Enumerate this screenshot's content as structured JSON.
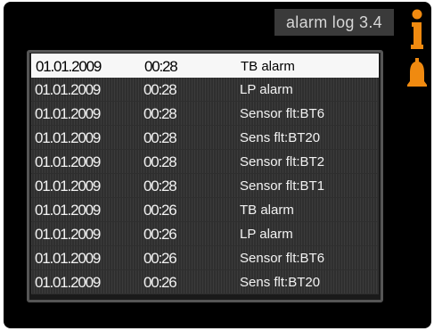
{
  "header": {
    "title": "alarm log",
    "menu_number": "3.4"
  },
  "icons": {
    "info": "info-icon",
    "alarm": "bell-icon",
    "accent_color": "#f08a10"
  },
  "log": {
    "rows": [
      {
        "date": "01.01.2009",
        "time": "00:28",
        "event": "TB alarm",
        "selected": true
      },
      {
        "date": "01.01.2009",
        "time": "00:28",
        "event": "LP alarm",
        "selected": false
      },
      {
        "date": "01.01.2009",
        "time": "00:28",
        "event": "Sensor flt:BT6",
        "selected": false
      },
      {
        "date": "01.01.2009",
        "time": "00:28",
        "event": "Sens flt:BT20",
        "selected": false
      },
      {
        "date": "01.01.2009",
        "time": "00:28",
        "event": "Sensor flt:BT2",
        "selected": false
      },
      {
        "date": "01.01.2009",
        "time": "00:28",
        "event": "Sensor flt:BT1",
        "selected": false
      },
      {
        "date": "01.01.2009",
        "time": "00:26",
        "event": "TB alarm",
        "selected": false
      },
      {
        "date": "01.01.2009",
        "time": "00:26",
        "event": "LP alarm",
        "selected": false
      },
      {
        "date": "01.01.2009",
        "time": "00:26",
        "event": "Sensor flt:BT6",
        "selected": false
      },
      {
        "date": "01.01.2009",
        "time": "00:26",
        "event": "Sens flt:BT20",
        "selected": false
      }
    ]
  }
}
